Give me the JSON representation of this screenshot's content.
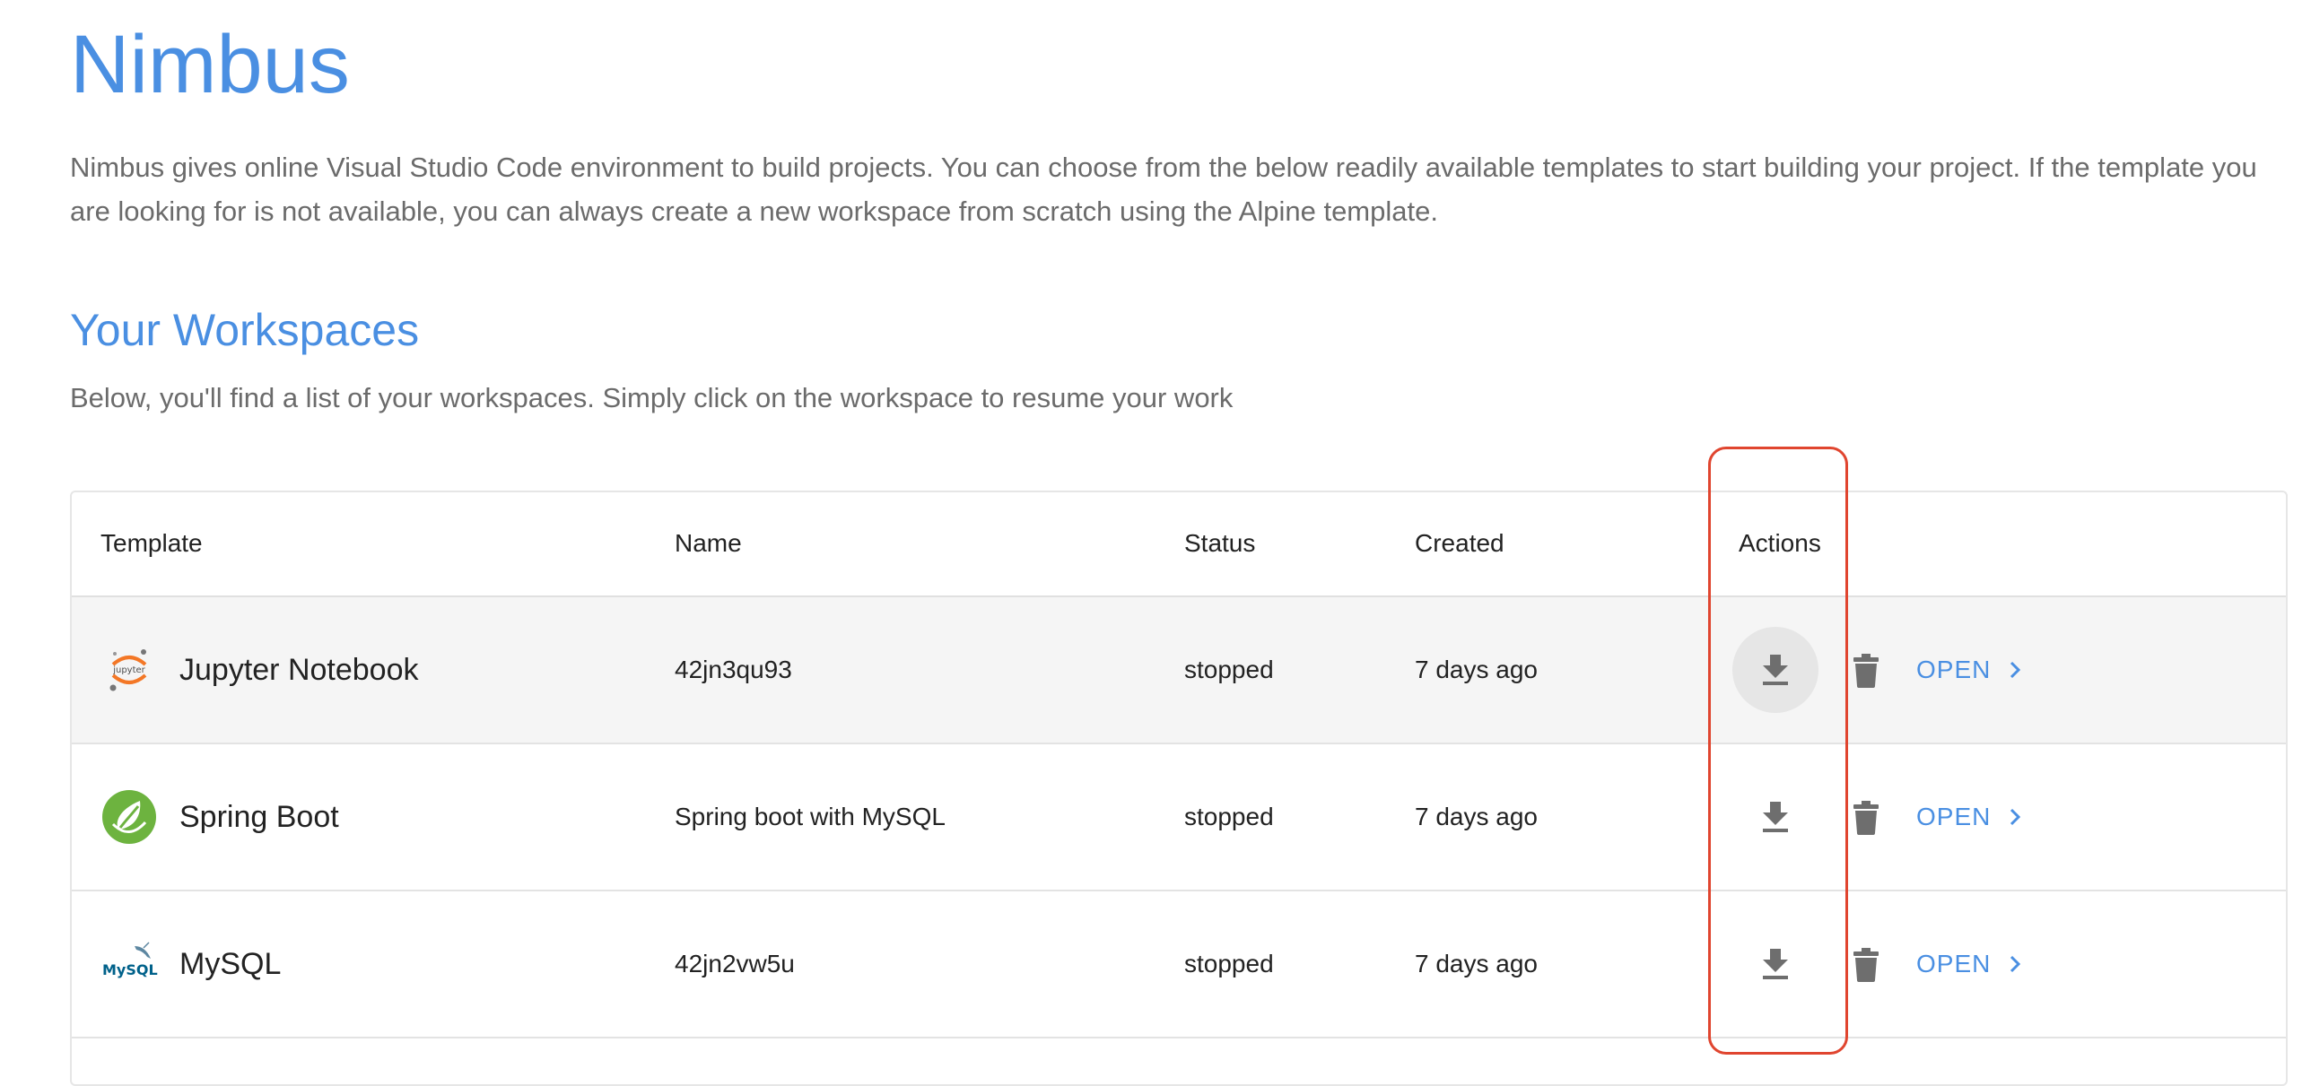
{
  "app": {
    "title": "Nimbus",
    "intro": "Nimbus gives online Visual Studio Code environment to build projects. You can choose from the below readily available templates to start building your project. If the template you are looking for is not available, you can always create a new workspace from scratch using the Alpine template."
  },
  "workspaces": {
    "title": "Your Workspaces",
    "description": "Below, you'll find a list of your workspaces. Simply click on the workspace to resume your work",
    "columns": {
      "template": "Template",
      "name": "Name",
      "status": "Status",
      "created": "Created",
      "actions": "Actions"
    },
    "rows": [
      {
        "template": "Jupyter Notebook",
        "logo_icon": "jupyter-logo-icon",
        "logo_text": "jupyter",
        "name": "42jn3qu93",
        "status": "stopped",
        "created": "7 days ago",
        "open_label": "OPEN"
      },
      {
        "template": "Spring Boot",
        "logo_icon": "spring-boot-logo-icon",
        "name": "Spring boot with MySQL",
        "status": "stopped",
        "created": "7 days ago",
        "open_label": "OPEN"
      },
      {
        "template": "MySQL",
        "logo_icon": "mysql-logo-icon",
        "logo_text": "MySQL",
        "name": "42jn2vw5u",
        "status": "stopped",
        "created": "7 days ago",
        "open_label": "OPEN"
      }
    ],
    "action_icons": [
      "download-icon",
      "trash-icon",
      "chevron-right-icon"
    ]
  },
  "colors": {
    "accent": "#4a8fe2",
    "text_muted": "#6b6b6b",
    "row_hover": "#f5f5f5",
    "highlight": "#e0452f",
    "icon_gray": "#6e6e6e"
  }
}
